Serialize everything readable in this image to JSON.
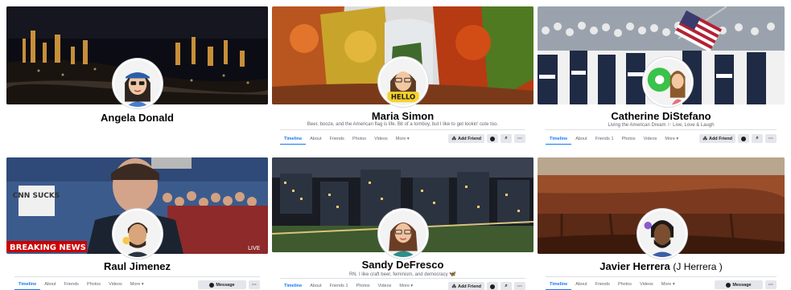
{
  "tabs": {
    "timeline": "Timeline",
    "about": "About",
    "friends": "Friends",
    "friends_notif": "Friends 1",
    "photos": "Photos",
    "videos": "Videos",
    "more": "More ▾"
  },
  "buttons": {
    "add_friend": "Add Friend",
    "message": "Message",
    "search_icon": "search-icon",
    "more_icon": "···"
  },
  "profiles": [
    {
      "name": "Angela Donald",
      "bio": ""
    },
    {
      "name": "Maria Simon",
      "bio": "Beer, booze, and the American flag is life. Bit of a tomboy, but I like to get lookin' cute too."
    },
    {
      "name": "Catherine DiStefano",
      "bio": "Living the American Dream ⚐ Live, Love & Laugh"
    },
    {
      "name": "Raul Jimenez",
      "bio": ""
    },
    {
      "name": "Sandy DeFresco",
      "bio": "RN. I like craft beer, feminism, and democracy"
    },
    {
      "name": "Javier Herrera",
      "alt": "(J Herrera )",
      "bio": ""
    }
  ],
  "cover_text": {
    "news_banner": "BREAKING NEWS",
    "live": "LIVE",
    "sign": "CNN SUCKS",
    "hello": "HELLO"
  },
  "colors": {
    "accent": "#1877f2",
    "button_bg": "#e4e6eb",
    "text_secondary": "#606770"
  }
}
